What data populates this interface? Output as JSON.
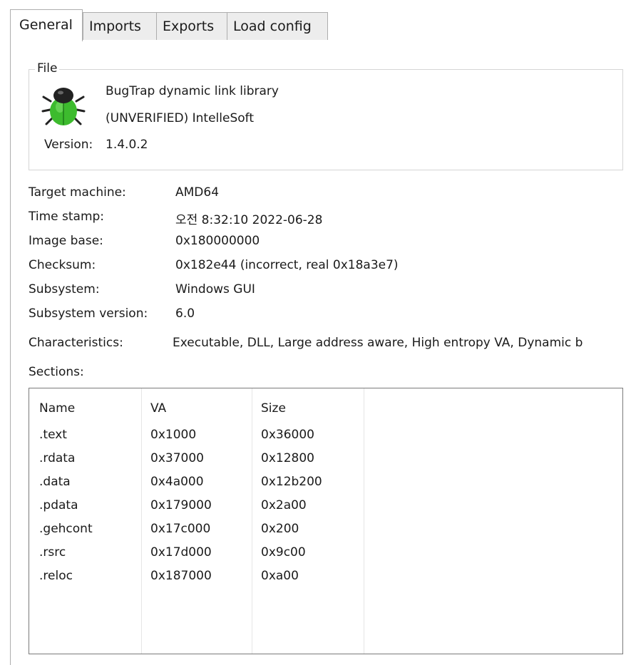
{
  "tabs": [
    {
      "label": "General"
    },
    {
      "label": "Imports"
    },
    {
      "label": "Exports"
    },
    {
      "label": "Load config"
    }
  ],
  "file": {
    "group_title": "File",
    "icon": "bug-icon",
    "description": "BugTrap dynamic link library",
    "company": "(UNVERIFIED) IntelleSoft",
    "version_label": "Version:",
    "version_value": "1.4.0.2"
  },
  "properties": {
    "target_machine": {
      "label": "Target machine:",
      "value": "AMD64"
    },
    "time_stamp": {
      "label": "Time stamp:",
      "value": "오전 8:32:10 2022-06-28"
    },
    "image_base": {
      "label": "Image base:",
      "value": "0x180000000"
    },
    "checksum": {
      "label": "Checksum:",
      "value": "0x182e44 (incorrect, real 0x18a3e7)"
    },
    "subsystem": {
      "label": "Subsystem:",
      "value": "Windows GUI"
    },
    "subsystem_version": {
      "label": "Subsystem version:",
      "value": "6.0"
    },
    "characteristics": {
      "label": "Characteristics:",
      "value": "Executable, DLL, Large address aware, High entropy VA, Dynamic b"
    }
  },
  "sections": {
    "title": "Sections:",
    "columns": [
      "Name",
      "VA",
      "Size"
    ],
    "rows": [
      [
        ".text",
        "0x1000",
        "0x36000"
      ],
      [
        ".rdata",
        "0x37000",
        "0x12800"
      ],
      [
        ".data",
        "0x4a000",
        "0x12b200"
      ],
      [
        ".pdata",
        "0x179000",
        "0x2a00"
      ],
      [
        ".gehcont",
        "0x17c000",
        "0x200"
      ],
      [
        ".rsrc",
        "0x17d000",
        "0x9c00"
      ],
      [
        ".reloc",
        "0x187000",
        "0xa00"
      ]
    ]
  },
  "colors": {
    "tab_inactive_bg": "#ededed",
    "border": "#adadad",
    "bug_body": "#3dbb2e",
    "bug_head": "#222222"
  }
}
